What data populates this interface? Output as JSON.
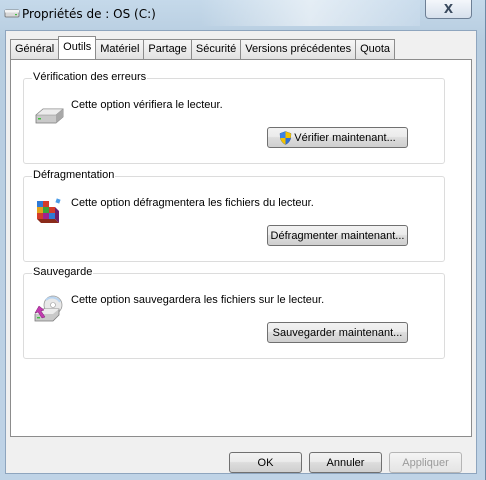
{
  "window": {
    "title": "Propriétés de : OS (C:)",
    "close_symbol": "X"
  },
  "tabs": [
    {
      "label": "Général",
      "active": false
    },
    {
      "label": "Outils",
      "active": true
    },
    {
      "label": "Matériel",
      "active": false
    },
    {
      "label": "Partage",
      "active": false
    },
    {
      "label": "Sécurité",
      "active": false
    },
    {
      "label": "Versions précédentes",
      "active": false
    },
    {
      "label": "Quota",
      "active": false
    }
  ],
  "groups": {
    "error_check": {
      "title": "Vérification des erreurs",
      "text": "Cette option vérifiera le lecteur.",
      "button_label": "Vérifier maintenant...",
      "icon": "drive-icon"
    },
    "defrag": {
      "title": "Défragmentation",
      "text": "Cette option défragmentera les fichiers du lecteur.",
      "button_label": "Défragmenter maintenant...",
      "icon": "defrag-icon"
    },
    "backup": {
      "title": "Sauvegarde",
      "text": "Cette option sauvegardera les fichiers sur le lecteur.",
      "button_label": "Sauvegarder maintenant...",
      "icon": "backup-icon"
    }
  },
  "footer": {
    "ok_label": "OK",
    "cancel_label": "Annuler",
    "apply_label": "Appliquer"
  }
}
